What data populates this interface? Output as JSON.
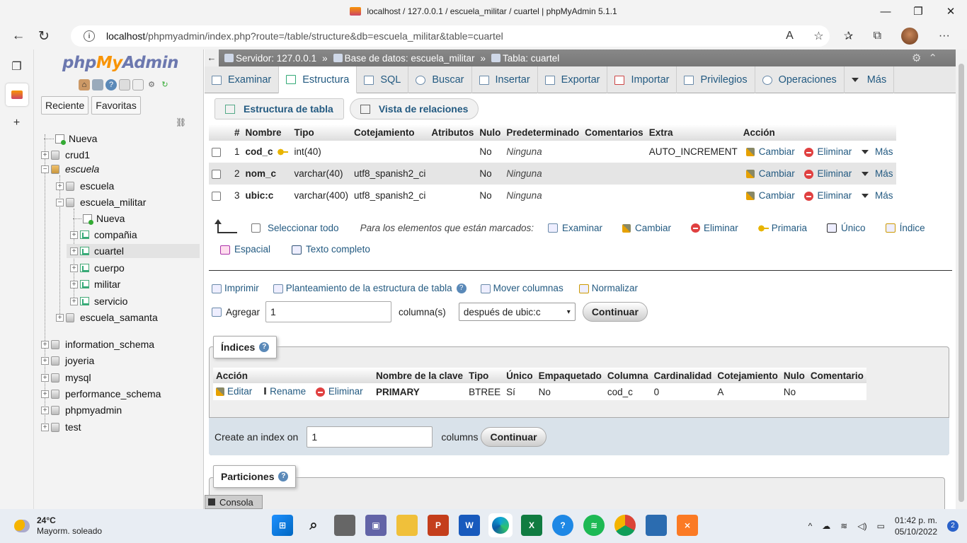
{
  "window": {
    "title": "localhost / 127.0.0.1 / escuela_militar / cuartel | phpMyAdmin 5.1.1",
    "controls": [
      "—",
      "❐",
      "✕"
    ]
  },
  "browser": {
    "url_host": "localhost",
    "url_path": "/phpmyadmin/index.php?route=/table/structure&db=escuela_militar&table=cuartel",
    "read_aloud_icon": "A",
    "tool_icons": [
      "☆",
      "✰",
      "⧉"
    ],
    "menu_icon": "···"
  },
  "pma_nav": {
    "logo_php": "php",
    "logo_my": "My",
    "logo_admin": "Admin",
    "tabs": [
      "Reciente",
      "Favoritas"
    ],
    "tree": [
      {
        "label": "Nueva",
        "type": "new",
        "level": 0
      },
      {
        "label": "crud1",
        "type": "db",
        "level": 0
      },
      {
        "label": "escuela",
        "type": "db-open",
        "level": 0
      },
      {
        "label": "escuela",
        "type": "db",
        "level": 1
      },
      {
        "label": "escuela_militar",
        "type": "db",
        "level": 1
      },
      {
        "label": "Nueva",
        "type": "new",
        "level": 2
      },
      {
        "label": "compañia",
        "type": "table",
        "level": 2
      },
      {
        "label": "cuartel",
        "type": "table",
        "level": 2,
        "selected": true
      },
      {
        "label": "cuerpo",
        "type": "table",
        "level": 2
      },
      {
        "label": "militar",
        "type": "table",
        "level": 2
      },
      {
        "label": "servicio",
        "type": "table",
        "level": 2
      },
      {
        "label": "escuela_samanta",
        "type": "db",
        "level": 1
      },
      {
        "label": "information_schema",
        "type": "db",
        "level": 0
      },
      {
        "label": "joyeria",
        "type": "db",
        "level": 0
      },
      {
        "label": "mysql",
        "type": "db",
        "level": 0
      },
      {
        "label": "performance_schema",
        "type": "db",
        "level": 0
      },
      {
        "label": "phpmyadmin",
        "type": "db",
        "level": 0
      },
      {
        "label": "test",
        "type": "db",
        "level": 0
      }
    ]
  },
  "breadcrumb": {
    "server": "Servidor: 127.0.0.1",
    "database": "Base de datos: escuela_militar",
    "table": "Tabla: cuartel",
    "separator": "»"
  },
  "main_tabs": [
    "Examinar",
    "Estructura",
    "SQL",
    "Buscar",
    "Insertar",
    "Exportar",
    "Importar",
    "Privilegios",
    "Operaciones",
    "Más"
  ],
  "sub_tabs": [
    "Estructura de tabla",
    "Vista de relaciones"
  ],
  "structure": {
    "headers": [
      "#",
      "Nombre",
      "Tipo",
      "Cotejamiento",
      "Atributos",
      "Nulo",
      "Predeterminado",
      "Comentarios",
      "Extra",
      "Acción"
    ],
    "rows": [
      {
        "num": "1",
        "name": "cod_c",
        "type": "int(40)",
        "collation": "",
        "attributes": "",
        "null": "No",
        "default": "Ninguna",
        "comments": "",
        "extra": "AUTO_INCREMENT"
      },
      {
        "num": "2",
        "name": "nom_c",
        "type": "varchar(40)",
        "collation": "utf8_spanish2_ci",
        "attributes": "",
        "null": "No",
        "default": "Ninguna",
        "comments": "",
        "extra": ""
      },
      {
        "num": "3",
        "name": "ubic:c",
        "type": "varchar(400)",
        "collation": "utf8_spanish2_ci",
        "attributes": "",
        "null": "No",
        "default": "Ninguna",
        "comments": "",
        "extra": ""
      }
    ],
    "row_actions": [
      "Cambiar",
      "Eliminar",
      "Más"
    ]
  },
  "bulk": {
    "select_all": "Seleccionar todo",
    "with_selected": "Para los elementos que están marcados:",
    "actions": [
      "Examinar",
      "Cambiar",
      "Eliminar",
      "Primaria",
      "Único",
      "Índice"
    ],
    "actions2": [
      "Espacial",
      "Texto completo"
    ]
  },
  "tools": {
    "print": "Imprimir",
    "plan": "Planteamiento de la estructura de tabla",
    "move": "Mover columnas",
    "normalize": "Normalizar",
    "add_label": "Agregar",
    "add_value": "1",
    "columns_label": "columna(s)",
    "position": "después de ubic:c",
    "continue": "Continuar"
  },
  "indexes": {
    "legend": "Índices",
    "headers": [
      "Acción",
      "Nombre de la clave",
      "Tipo",
      "Único",
      "Empaquetado",
      "Columna",
      "Cardinalidad",
      "Cotejamiento",
      "Nulo",
      "Comentario"
    ],
    "actions": [
      "Editar",
      "Rename",
      "Eliminar"
    ],
    "row": {
      "key": "PRIMARY",
      "type": "BTREE",
      "unique": "Sí",
      "packed": "No",
      "column": "cod_c",
      "cardinality": "0",
      "collation": "A",
      "null": "No",
      "comment": ""
    },
    "create_label": "Create an index on",
    "create_value": "1",
    "columns_label": "columns",
    "continue": "Continuar"
  },
  "partitions": {
    "legend": "Particiones"
  },
  "console": "Consola",
  "taskbar": {
    "temp": "24°C",
    "weather": "Mayorm. soleado",
    "time": "01:42 p. m.",
    "date": "05/10/2022",
    "notifications": "2",
    "tray_icons": [
      "^",
      "☁",
      "≋",
      "◁)",
      "▭"
    ]
  }
}
